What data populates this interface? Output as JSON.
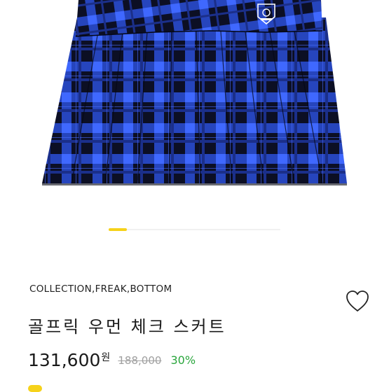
{
  "product": {
    "breadcrumb": "COLLECTION,FREAK,BOTTOM",
    "title": "골프릭 우먼 체크 스커트",
    "sale_price": "131,600",
    "currency": "원",
    "original_price": "188,000",
    "discount": "30%"
  },
  "carousel": {
    "active_index": 0,
    "slide_count": 8
  },
  "colors": {
    "plaid_blue": "#2a4fd8",
    "plaid_black": "#0c0f24",
    "carousel_active": "#f6d21a",
    "discount_green": "#2aa63d"
  },
  "icons": {
    "wish": "heart-outline-icon",
    "emblem": "crest-logo"
  }
}
